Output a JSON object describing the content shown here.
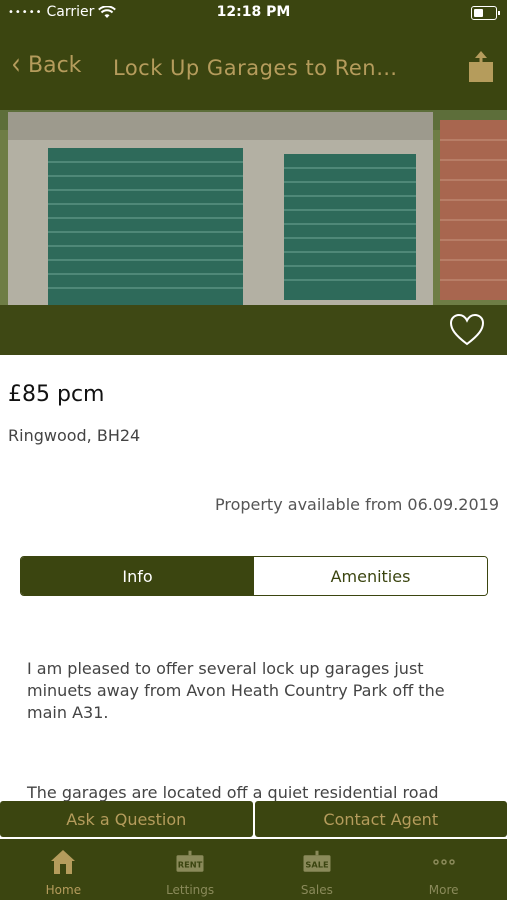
{
  "status": {
    "carrier": "Carrier",
    "time": "12:18 PM"
  },
  "nav": {
    "back_label": "Back",
    "title": "Lock Up Garages to Ren…"
  },
  "listing": {
    "price": "£85 pcm",
    "location": "Ringwood, BH24",
    "availability": "Property available from 06.09.2019"
  },
  "tabs": [
    {
      "label": "Info",
      "active": true
    },
    {
      "label": "Amenities",
      "active": false
    }
  ],
  "description": {
    "para1": "I am pleased to offer several lock up garages just minuets away from Avon Heath Country Park off the main A31.",
    "para2": "The garages are located off a quiet residential road"
  },
  "actions": {
    "ask": "Ask a Question",
    "contact": "Contact Agent"
  },
  "tabbar": [
    {
      "label": "Home",
      "icon": "home-icon",
      "badge": ""
    },
    {
      "label": "Lettings",
      "icon": "rent-sign-icon",
      "badge": "RENT"
    },
    {
      "label": "Sales",
      "icon": "sale-sign-icon",
      "badge": "SALE"
    },
    {
      "label": "More",
      "icon": "more-icon",
      "badge": ""
    }
  ],
  "colors": {
    "brand": "#3b4510",
    "accent": "#b59c5c"
  }
}
